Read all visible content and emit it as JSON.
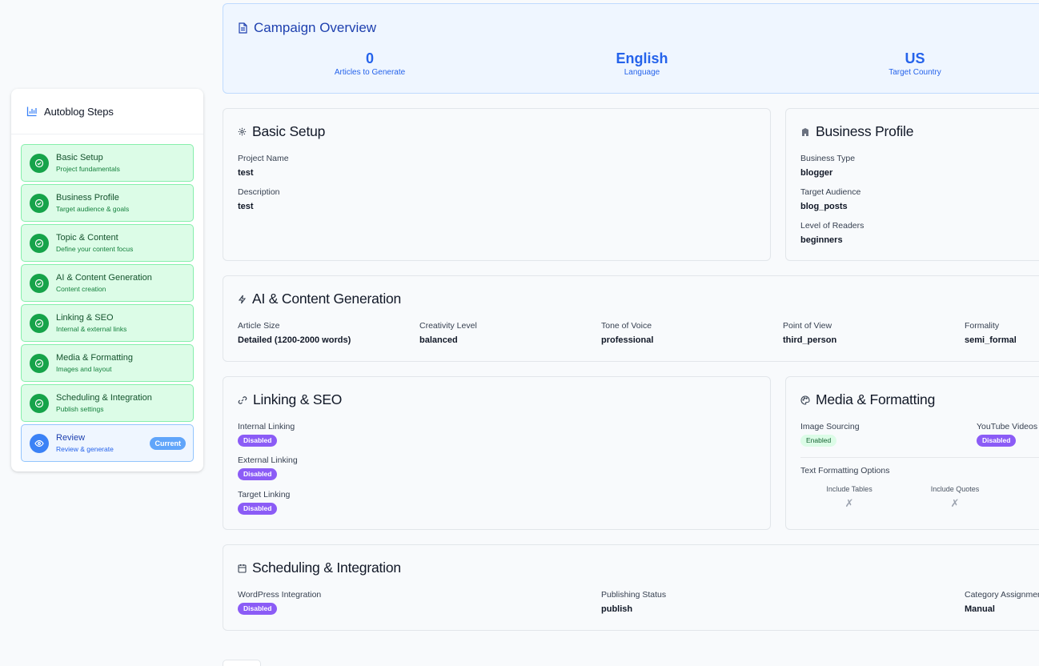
{
  "sidebar": {
    "title": "Autoblog Steps",
    "icon": "bar-chart-icon",
    "current_badge": "Current",
    "steps": [
      {
        "label": "Basic Setup",
        "sub": "Project fundamentals"
      },
      {
        "label": "Business Profile",
        "sub": "Target audience & goals"
      },
      {
        "label": "Topic & Content",
        "sub": "Define your content focus"
      },
      {
        "label": "AI & Content Generation",
        "sub": "Content creation"
      },
      {
        "label": "Linking & SEO",
        "sub": "Internal & external links"
      },
      {
        "label": "Media & Formatting",
        "sub": "Images and layout"
      },
      {
        "label": "Scheduling & Integration",
        "sub": "Publish settings"
      },
      {
        "label": "Review",
        "sub": "Review & generate"
      }
    ]
  },
  "overview": {
    "title": "Campaign Overview",
    "stats": [
      {
        "value": "0",
        "label": "Articles to Generate"
      },
      {
        "value": "English",
        "label": "Language"
      },
      {
        "value": "US",
        "label": "Target Country"
      }
    ]
  },
  "basic_setup": {
    "title": "Basic Setup",
    "project_name_label": "Project Name",
    "project_name": "test",
    "description_label": "Description",
    "description": "test"
  },
  "business_profile": {
    "title": "Business Profile",
    "type_label": "Business Type",
    "type": "blogger",
    "audience_label": "Target Audience",
    "audience": "blog_posts",
    "level_label": "Level of Readers",
    "level": "beginners"
  },
  "ai_content": {
    "title": "AI & Content Generation",
    "fields": [
      {
        "label": "Article Size",
        "value": "Detailed (1200-2000 words)"
      },
      {
        "label": "Creativity Level",
        "value": "balanced"
      },
      {
        "label": "Tone of Voice",
        "value": "professional"
      },
      {
        "label": "Point of View",
        "value": "third_person"
      },
      {
        "label": "Formality",
        "value": "semi_formal"
      }
    ]
  },
  "linking": {
    "title": "Linking & SEO",
    "internal_label": "Internal Linking",
    "internal": "Disabled",
    "external_label": "External Linking",
    "external": "Disabled",
    "target_label": "Target Linking",
    "target": "Disabled"
  },
  "media": {
    "title": "Media & Formatting",
    "image_label": "Image Sourcing",
    "image": "Enabled",
    "youtube_label": "YouTube Videos",
    "youtube": "Disabled",
    "text_opts_label": "Text Formatting Options",
    "tables_label": "Include Tables",
    "tables": "✗",
    "quotes_label": "Include Quotes",
    "quotes": "✗"
  },
  "scheduling": {
    "title": "Scheduling & Integration",
    "wp_label": "WordPress Integration",
    "wp": "Disabled",
    "status_label": "Publishing Status",
    "status": "publish",
    "category_label": "Category Assignment",
    "category": "Manual"
  },
  "colors": {
    "accent": "#2563eb",
    "success": "#16a34a",
    "badge_disabled": "#8b5cf6"
  }
}
